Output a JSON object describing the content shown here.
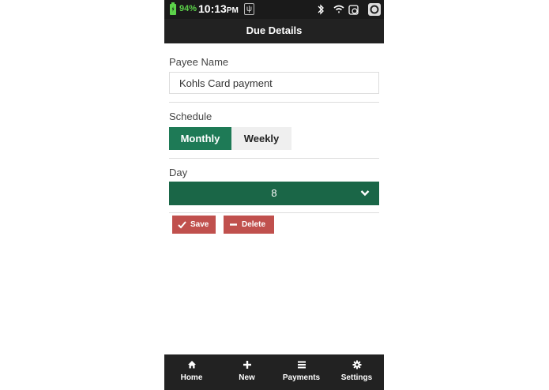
{
  "status_bar": {
    "battery_percent": "94%",
    "time": "10:13",
    "ampm": "PM"
  },
  "header": {
    "title": "Due Details"
  },
  "form": {
    "payee_label": "Payee Name",
    "payee_value": "Kohls Card payment",
    "schedule_label": "Schedule",
    "schedule_options": [
      "Monthly",
      "Weekly"
    ],
    "schedule_selected": "Monthly",
    "day_label": "Day",
    "day_value": "8"
  },
  "actions": {
    "save_label": "Save",
    "delete_label": "Delete"
  },
  "nav": {
    "items": [
      {
        "label": "Home",
        "icon": "home-icon"
      },
      {
        "label": "New",
        "icon": "plus-icon"
      },
      {
        "label": "Payments",
        "icon": "list-icon"
      },
      {
        "label": "Settings",
        "icon": "gear-icon"
      }
    ]
  },
  "colors": {
    "accent_green": "#1e7a56",
    "select_green": "#1a6647",
    "danger_red": "#c0504d",
    "bar_dark": "#222222"
  }
}
